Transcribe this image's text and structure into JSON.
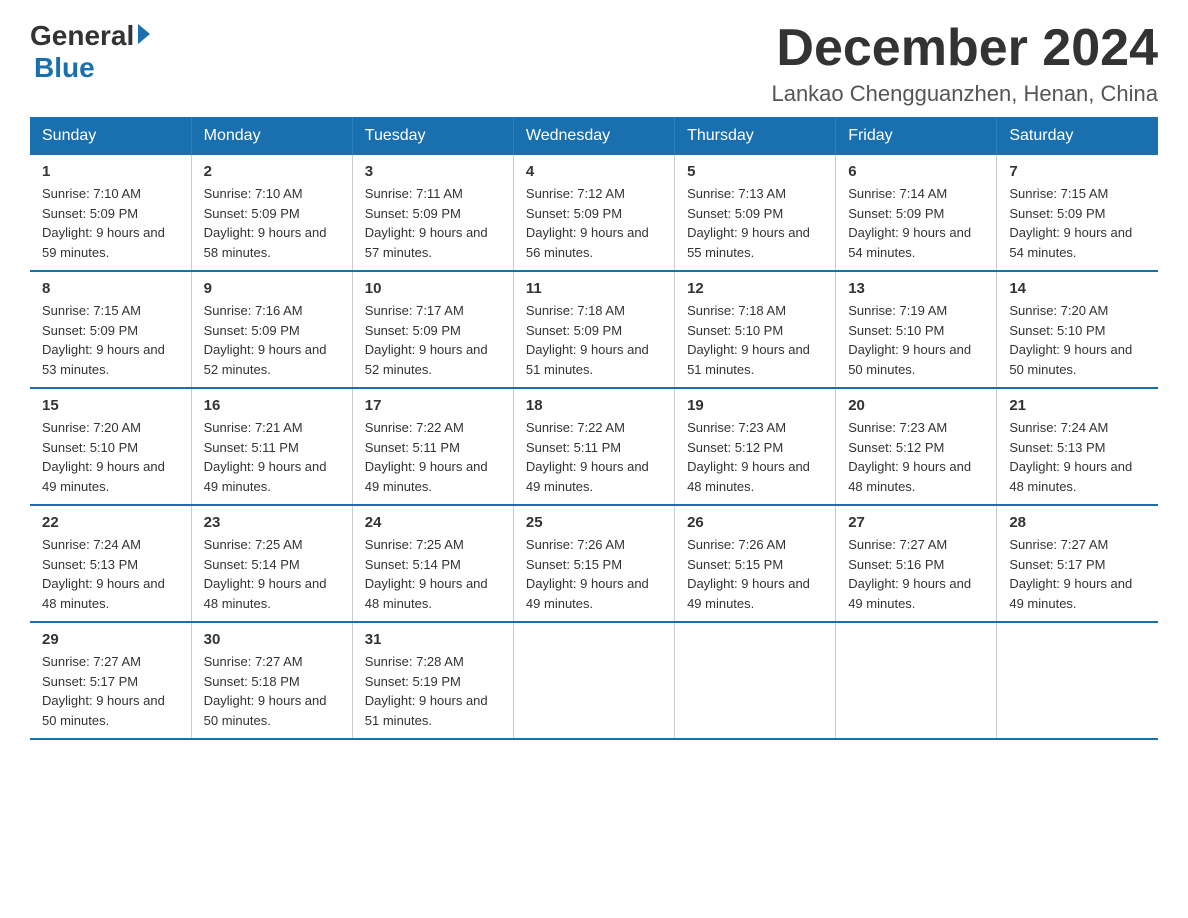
{
  "logo": {
    "general": "General",
    "blue": "Blue",
    "subtitle": "Blue"
  },
  "title": "December 2024",
  "location": "Lankao Chengguanzhen, Henan, China",
  "days_of_week": [
    "Sunday",
    "Monday",
    "Tuesday",
    "Wednesday",
    "Thursday",
    "Friday",
    "Saturday"
  ],
  "weeks": [
    [
      {
        "day": "1",
        "sunrise": "7:10 AM",
        "sunset": "5:09 PM",
        "daylight": "9 hours and 59 minutes."
      },
      {
        "day": "2",
        "sunrise": "7:10 AM",
        "sunset": "5:09 PM",
        "daylight": "9 hours and 58 minutes."
      },
      {
        "day": "3",
        "sunrise": "7:11 AM",
        "sunset": "5:09 PM",
        "daylight": "9 hours and 57 minutes."
      },
      {
        "day": "4",
        "sunrise": "7:12 AM",
        "sunset": "5:09 PM",
        "daylight": "9 hours and 56 minutes."
      },
      {
        "day": "5",
        "sunrise": "7:13 AM",
        "sunset": "5:09 PM",
        "daylight": "9 hours and 55 minutes."
      },
      {
        "day": "6",
        "sunrise": "7:14 AM",
        "sunset": "5:09 PM",
        "daylight": "9 hours and 54 minutes."
      },
      {
        "day": "7",
        "sunrise": "7:15 AM",
        "sunset": "5:09 PM",
        "daylight": "9 hours and 54 minutes."
      }
    ],
    [
      {
        "day": "8",
        "sunrise": "7:15 AM",
        "sunset": "5:09 PM",
        "daylight": "9 hours and 53 minutes."
      },
      {
        "day": "9",
        "sunrise": "7:16 AM",
        "sunset": "5:09 PM",
        "daylight": "9 hours and 52 minutes."
      },
      {
        "day": "10",
        "sunrise": "7:17 AM",
        "sunset": "5:09 PM",
        "daylight": "9 hours and 52 minutes."
      },
      {
        "day": "11",
        "sunrise": "7:18 AM",
        "sunset": "5:09 PM",
        "daylight": "9 hours and 51 minutes."
      },
      {
        "day": "12",
        "sunrise": "7:18 AM",
        "sunset": "5:10 PM",
        "daylight": "9 hours and 51 minutes."
      },
      {
        "day": "13",
        "sunrise": "7:19 AM",
        "sunset": "5:10 PM",
        "daylight": "9 hours and 50 minutes."
      },
      {
        "day": "14",
        "sunrise": "7:20 AM",
        "sunset": "5:10 PM",
        "daylight": "9 hours and 50 minutes."
      }
    ],
    [
      {
        "day": "15",
        "sunrise": "7:20 AM",
        "sunset": "5:10 PM",
        "daylight": "9 hours and 49 minutes."
      },
      {
        "day": "16",
        "sunrise": "7:21 AM",
        "sunset": "5:11 PM",
        "daylight": "9 hours and 49 minutes."
      },
      {
        "day": "17",
        "sunrise": "7:22 AM",
        "sunset": "5:11 PM",
        "daylight": "9 hours and 49 minutes."
      },
      {
        "day": "18",
        "sunrise": "7:22 AM",
        "sunset": "5:11 PM",
        "daylight": "9 hours and 49 minutes."
      },
      {
        "day": "19",
        "sunrise": "7:23 AM",
        "sunset": "5:12 PM",
        "daylight": "9 hours and 48 minutes."
      },
      {
        "day": "20",
        "sunrise": "7:23 AM",
        "sunset": "5:12 PM",
        "daylight": "9 hours and 48 minutes."
      },
      {
        "day": "21",
        "sunrise": "7:24 AM",
        "sunset": "5:13 PM",
        "daylight": "9 hours and 48 minutes."
      }
    ],
    [
      {
        "day": "22",
        "sunrise": "7:24 AM",
        "sunset": "5:13 PM",
        "daylight": "9 hours and 48 minutes."
      },
      {
        "day": "23",
        "sunrise": "7:25 AM",
        "sunset": "5:14 PM",
        "daylight": "9 hours and 48 minutes."
      },
      {
        "day": "24",
        "sunrise": "7:25 AM",
        "sunset": "5:14 PM",
        "daylight": "9 hours and 48 minutes."
      },
      {
        "day": "25",
        "sunrise": "7:26 AM",
        "sunset": "5:15 PM",
        "daylight": "9 hours and 49 minutes."
      },
      {
        "day": "26",
        "sunrise": "7:26 AM",
        "sunset": "5:15 PM",
        "daylight": "9 hours and 49 minutes."
      },
      {
        "day": "27",
        "sunrise": "7:27 AM",
        "sunset": "5:16 PM",
        "daylight": "9 hours and 49 minutes."
      },
      {
        "day": "28",
        "sunrise": "7:27 AM",
        "sunset": "5:17 PM",
        "daylight": "9 hours and 49 minutes."
      }
    ],
    [
      {
        "day": "29",
        "sunrise": "7:27 AM",
        "sunset": "5:17 PM",
        "daylight": "9 hours and 50 minutes."
      },
      {
        "day": "30",
        "sunrise": "7:27 AM",
        "sunset": "5:18 PM",
        "daylight": "9 hours and 50 minutes."
      },
      {
        "day": "31",
        "sunrise": "7:28 AM",
        "sunset": "5:19 PM",
        "daylight": "9 hours and 51 minutes."
      },
      null,
      null,
      null,
      null
    ]
  ]
}
